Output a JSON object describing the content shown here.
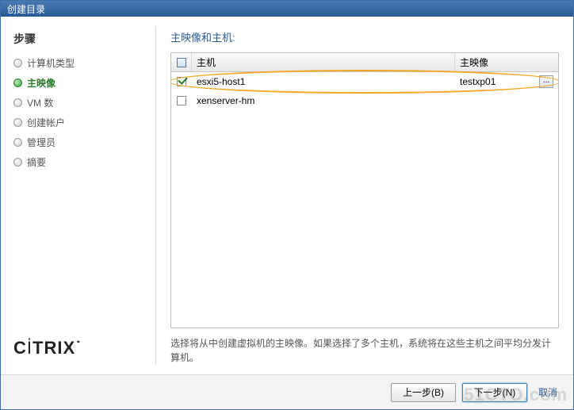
{
  "window": {
    "title": "创建目录"
  },
  "sidebar": {
    "title": "步骤",
    "steps": [
      {
        "label": "计算机类型"
      },
      {
        "label": "主映像"
      },
      {
        "label": "VM 数"
      },
      {
        "label": "创建帐户"
      },
      {
        "label": "管理员"
      },
      {
        "label": "摘要"
      }
    ],
    "brand": "CİTRIX"
  },
  "main": {
    "title": "主映像和主机:",
    "columns": {
      "host": "主机",
      "image": "主映像"
    },
    "rows": [
      {
        "host": "esxi5-host1",
        "image": "testxp01",
        "checked": true,
        "browsable": true
      },
      {
        "host": "xenserver-hm",
        "image": "",
        "checked": false,
        "browsable": false
      }
    ],
    "hint": "选择将从中创建虚拟机的主映像。如果选择了多个主机，系统将在这些主机之间平均分发计算机。",
    "browse_btn": "..."
  },
  "footer": {
    "back": "上一步(B)",
    "next": "下一步(N)",
    "cancel": "取消"
  },
  "watermark": "51CTO.com"
}
